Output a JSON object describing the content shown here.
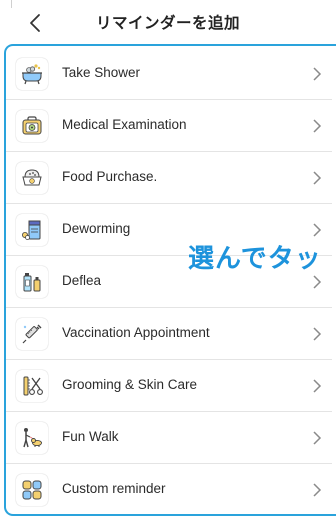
{
  "header": {
    "back_icon": "chevron-left-icon",
    "title": "リマインダーを追加"
  },
  "reminders": [
    {
      "label": "Take Shower",
      "icon": "bathtub-icon"
    },
    {
      "label": "Medical Examination",
      "icon": "medical-bag-icon"
    },
    {
      "label": "Food Purchase.",
      "icon": "pet-food-bowl-icon"
    },
    {
      "label": "Deworming",
      "icon": "medicine-box-icon"
    },
    {
      "label": "Deflea",
      "icon": "flea-spray-icon"
    },
    {
      "label": "Vaccination Appointment",
      "icon": "syringe-icon"
    },
    {
      "label": "Grooming & Skin Care",
      "icon": "scissors-comb-icon"
    },
    {
      "label": "Fun Walk",
      "icon": "dog-walk-icon"
    },
    {
      "label": "Custom reminder",
      "icon": "grid-tiles-icon"
    }
  ],
  "overlay": {
    "text": "選んでタッ"
  },
  "colors": {
    "accent": "#2aa3dc",
    "overlay_text": "#1d93dc",
    "divider": "#e4e4e4",
    "chevron": "#8a8a8a"
  }
}
